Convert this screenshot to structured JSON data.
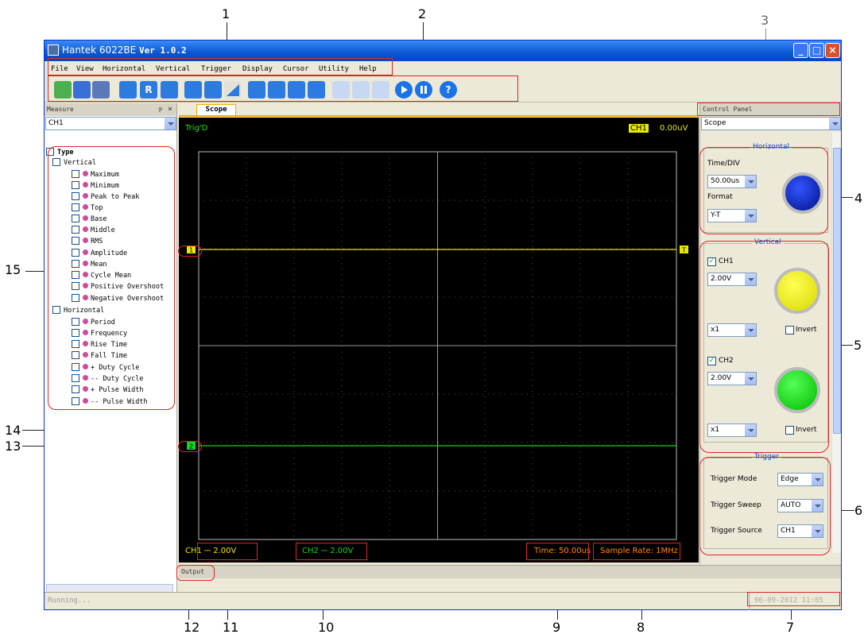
{
  "window": {
    "title_prefix": "Hantek 6022BE ",
    "title_version": "Ver 1.0.2",
    "minimize": "_",
    "maximize": "□",
    "close": "×"
  },
  "menu": [
    "File",
    "View",
    "Horizontal",
    "Vertical",
    "Trigger",
    "Display",
    "Cursor",
    "Utility",
    "Help"
  ],
  "toolbar": {
    "icons": [
      "open-icon",
      "save-icon",
      "print-icon",
      "auto-set-icon",
      "reset-icon",
      "refresh-icon",
      "pulse-icon",
      "pulse-width-icon",
      "ramp-icon",
      "cursor-icon",
      "grid-icon",
      "dots-icon",
      "lines-icon",
      "step-icon",
      "sine-icon",
      "wave-icon",
      "run-icon",
      "pause-icon",
      "help-icon"
    ],
    "reset_label": "R",
    "help_label": "?"
  },
  "measure_panel": {
    "title": "Measure",
    "pin": "ᵽ",
    "close": "×",
    "channel": "CH1",
    "tree": {
      "root": "Type",
      "vertical_group": "Vertical",
      "vertical_items": [
        "Maximum",
        "Minimum",
        "Peak to Peak",
        "Top",
        "Base",
        "Middle",
        "RMS",
        "Amplitude",
        "Mean",
        "Cycle Mean",
        "Positive Overshoot",
        "Negative Overshoot"
      ],
      "horizontal_group": "Horizontal",
      "horizontal_items": [
        "Period",
        "Frequency",
        "Rise Time",
        "Fall Time",
        "+ Duty Cycle",
        "-- Duty Cycle",
        "+ Pulse Width",
        "-- Pulse Width"
      ]
    }
  },
  "scope": {
    "tab": "Scope",
    "trig_status": "Trig'D",
    "trigger_channel": "CH1",
    "trigger_level": "0.00uV",
    "ch1_marker": "1",
    "ch2_marker": "2",
    "trigger_marker": "T",
    "ch1_scale": "CH1 ⎓ 2.00V",
    "ch2_scale": "CH2 ⎓ 2.00V",
    "time": "Time: 50.00us",
    "sample_rate": "Sample Rate: 1MHz",
    "colors": {
      "ch1": "#e8e800",
      "ch2": "#22cc22",
      "grid": "#7a7a7a",
      "background": "#000000"
    }
  },
  "control_panel": {
    "title": "Control Panel",
    "view": "Scope",
    "horizontal": {
      "title": "Horizontal",
      "time_div_label": "Time/DIV",
      "time_div": "50.00us",
      "format_label": "Format",
      "format": "Y-T"
    },
    "vertical": {
      "title": "Vertical",
      "ch1_label": "CH1",
      "ch1_volt": "2.00V",
      "ch1_probe": "x1",
      "ch2_label": "CH2",
      "ch2_volt": "2.00V",
      "ch2_probe": "x1",
      "invert_label": "Invert"
    },
    "trigger": {
      "title": "Trigger",
      "mode_label": "Trigger Mode",
      "mode": "Edge",
      "sweep_label": "Trigger Sweep",
      "sweep": "AUTO",
      "source_label": "Trigger Source",
      "source": "CH1"
    }
  },
  "output": {
    "title": "Output"
  },
  "status": {
    "left": "Running...",
    "datetime": "06-09-2012  11:05"
  },
  "callouts": [
    "1",
    "2",
    "3",
    "4",
    "5",
    "6",
    "7",
    "8",
    "9",
    "10",
    "11",
    "12",
    "13",
    "14",
    "15"
  ]
}
